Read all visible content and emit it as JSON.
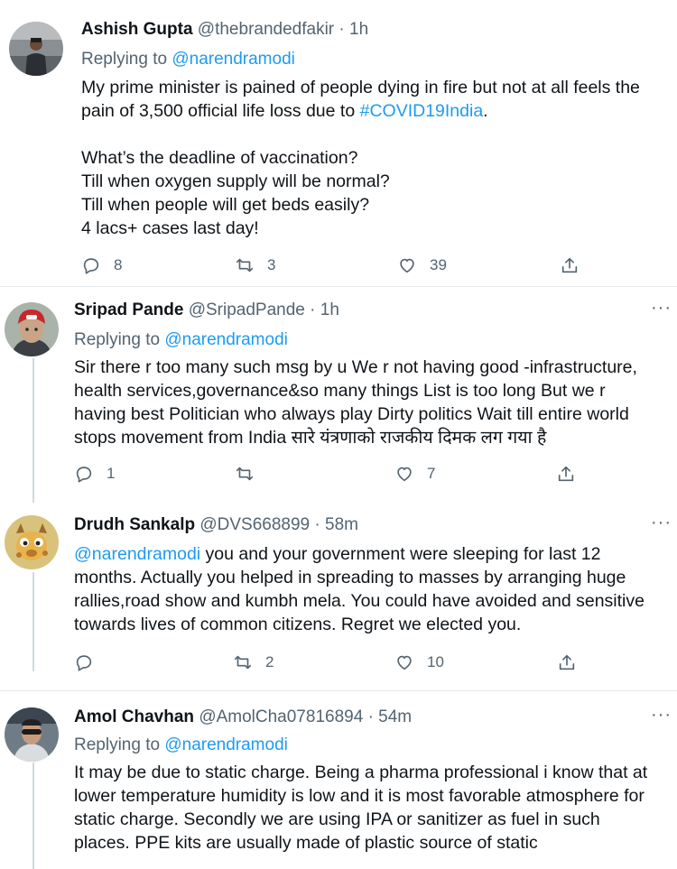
{
  "tweets": [
    {
      "name": "Ashish Gupta",
      "handle": "@thebrandedfakir",
      "time": "1h",
      "reply_label": "Replying to",
      "reply_to": "@narendramodi",
      "lines": [
        "My prime minister is pained of people dying in fire but not at all feels the",
        "pain of 3,500 official life loss due to ",
        "",
        "What’s the deadline of vaccination?",
        "Till when oxygen supply will be normal?",
        "Till when people will get beds easily?",
        "4 lacs+ cases last day!"
      ],
      "hashtag": "#COVID19India",
      "hashtag_suffix": ".",
      "replies": "8",
      "retweets": "3",
      "likes": "39"
    },
    {
      "name": "Sripad Pande",
      "handle": "@SripadPande",
      "time": "1h",
      "reply_label": "Replying to",
      "reply_to": "@narendramodi",
      "lines": [
        "Sir there r too many such msg by u We r not having good -infrastructure,",
        "health services,governance&so many things List is too long But we r",
        "having best Politician who always play Dirty politics Wait till entire world",
        "stops movement from India सारे यंत्रणाको राजकीय दिमक लग गया है"
      ],
      "replies": "1",
      "retweets": "",
      "likes": "7"
    },
    {
      "name": "Drudh Sankalp",
      "handle": "@DVS668899",
      "time": "58m",
      "mention": "@narendramodi",
      "lines": [
        " you and your government were sleeping for last 12",
        "months. Actually you helped in spreading to masses by arranging huge",
        "rallies,road show and kumbh mela. You could have avoided and sensitive",
        "towards lives of common citizens. Regret we elected you."
      ],
      "replies": "",
      "retweets": "2",
      "likes": "10"
    },
    {
      "name": "Amol Chavhan",
      "handle": "@AmolCha07816894",
      "time": "54m",
      "reply_label": "Replying to",
      "reply_to": "@narendramodi",
      "lines": [
        "It may be due to static charge. Being a pharma professional i know that at",
        "lower temperature humidity is low and it is most favorable atmosphere for",
        "static charge. Secondly we are using IPA or sanitizer as fuel in such",
        "places. PPE kits are usually made of plastic source of static"
      ]
    }
  ],
  "separator": "·",
  "more_glyph": "···",
  "colors": {
    "link": "#1d9bf0",
    "muted": "#536471",
    "text": "#0f1419",
    "thread": "#cfd9de"
  }
}
